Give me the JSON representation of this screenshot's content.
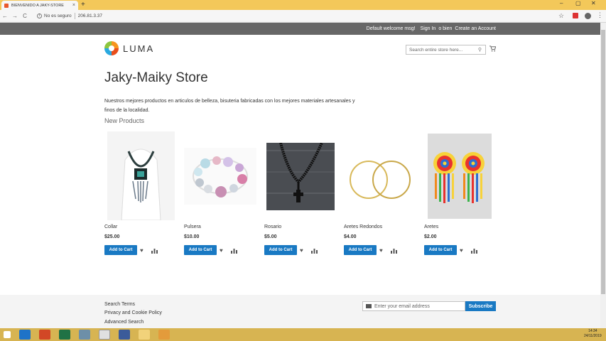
{
  "browser": {
    "tab_title": "BIENVENIDO A JAKY-STORE",
    "tab_close": "×",
    "new_tab": "+",
    "security_text": "No es seguro",
    "address": "206.81.3.37",
    "back": "←",
    "forward": "→",
    "reload": "C",
    "bookmark_star": "☆",
    "menu": "⋮"
  },
  "header": {
    "welcome": "Default welcome msg!",
    "sign_in": "Sign In",
    "or": "o bien",
    "create_account": "Create an Account",
    "logo_text": "LUMA",
    "search_placeholder": "Search entire store here..."
  },
  "main": {
    "title": "Jaky-Maiky Store",
    "description": "Nuestros mejores productos en articulos de belleza, bisuteria fabricadas con los mejores materiales artesanales y finos de la localidad.",
    "section_title": "New Products",
    "add_to_cart_label": "Add to Cart",
    "products": [
      {
        "name": "Collar",
        "price": "$25.00"
      },
      {
        "name": "Pulsera",
        "price": "$10.00"
      },
      {
        "name": "Rosario",
        "price": "$5.00"
      },
      {
        "name": "Aretes Redondos",
        "price": "$4.00"
      },
      {
        "name": "Aretes",
        "price": "$2.00"
      }
    ]
  },
  "footer": {
    "links": [
      "Search Terms",
      "Privacy and Cookie Policy",
      "Advanced Search"
    ],
    "email_placeholder": "Enter your email address",
    "subscribe_label": "Subscribe"
  },
  "taskbar": {
    "time": "14:34",
    "date": "24/11/2019"
  }
}
